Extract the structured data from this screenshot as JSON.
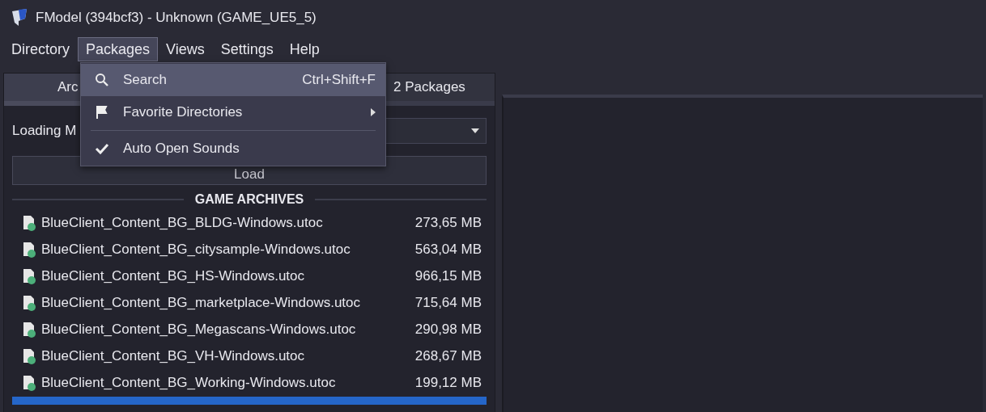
{
  "window": {
    "title": "FModel (394bcf3) - Unknown (GAME_UE5_5)"
  },
  "menu_bar": [
    {
      "label": "Directory",
      "open": false
    },
    {
      "label": "Packages",
      "open": true
    },
    {
      "label": "Views",
      "open": false
    },
    {
      "label": "Settings",
      "open": false
    },
    {
      "label": "Help",
      "open": false
    }
  ],
  "menu": {
    "items": [
      {
        "kind": "command",
        "label": "Search",
        "shortcut": "Ctrl+Shift+F",
        "highlighted": true
      },
      {
        "kind": "submenu",
        "label": "Favorite Directories",
        "highlighted": false
      },
      {
        "kind": "separator"
      },
      {
        "kind": "toggle",
        "label": "Auto Open Sounds",
        "checked": true,
        "highlighted": false
      }
    ]
  },
  "tabs": [
    {
      "label": "Arc",
      "selected": true
    },
    {
      "label": "2 Packages",
      "selected": false
    }
  ],
  "loading_mode": {
    "label": "Loading M"
  },
  "load_button": {
    "label": "Load"
  },
  "archives": {
    "heading": "GAME ARCHIVES",
    "rows": [
      {
        "name": "BlueClient_Content_BG_BLDG-Windows.utoc",
        "size": "273,65 MB"
      },
      {
        "name": "BlueClient_Content_BG_citysample-Windows.utoc",
        "size": "563,04 MB"
      },
      {
        "name": "BlueClient_Content_BG_HS-Windows.utoc",
        "size": "966,15 MB"
      },
      {
        "name": "BlueClient_Content_BG_marketplace-Windows.utoc",
        "size": "715,64 MB"
      },
      {
        "name": "BlueClient_Content_BG_Megascans-Windows.utoc",
        "size": "290,98 MB"
      },
      {
        "name": "BlueClient_Content_BG_VH-Windows.utoc",
        "size": "268,67 MB"
      },
      {
        "name": "BlueClient_Content_BG_Working-Windows.utoc",
        "size": "199,12 MB"
      }
    ]
  }
}
